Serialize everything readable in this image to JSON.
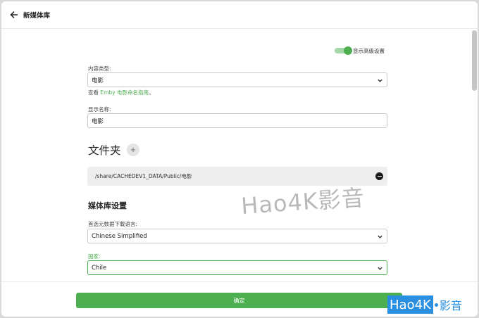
{
  "header": {
    "title": "新媒体库"
  },
  "advanced_toggle": {
    "label": "显示高级设置",
    "on": true,
    "color": "#4caf50"
  },
  "content_type": {
    "label": "内容类型:",
    "value": "电影"
  },
  "hint": {
    "prefix": "查看 ",
    "link": "Emby 电影命名指南",
    "suffix": "。"
  },
  "display_name": {
    "label": "显示名称:",
    "value": "电影"
  },
  "folders": {
    "title": "文件夹",
    "add_icon": "plus-icon",
    "items": [
      {
        "path": "/share/CACHEDEV1_DATA/Public/电影",
        "remove_icon": "minus-circle-icon"
      }
    ]
  },
  "library_settings": {
    "title": "媒体库设置",
    "metadata_language": {
      "label": "首选元数据下载语言:",
      "value": "Chinese Simplified"
    },
    "country": {
      "label": "国家:",
      "value": "Chile"
    }
  },
  "watermark": {
    "text": "Hao4K影音"
  },
  "footer": {
    "ok_label": "确定"
  },
  "logo": {
    "box": "Hao4K",
    "rest": "影音"
  },
  "colors": {
    "accent": "#4caf50",
    "logo_blue": "#2a8fe0"
  }
}
